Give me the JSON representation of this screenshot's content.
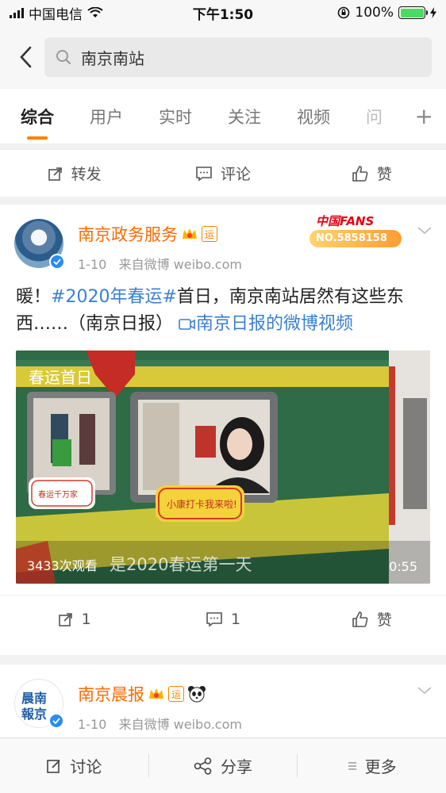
{
  "status": {
    "carrier": "中国电信",
    "time": "下午1:50",
    "battery": "100%",
    "battery_level": 1.0
  },
  "search": {
    "query": "南京南站"
  },
  "tabs": [
    {
      "label": "综合"
    },
    {
      "label": "用户"
    },
    {
      "label": "实时"
    },
    {
      "label": "关注"
    },
    {
      "label": "视频"
    },
    {
      "label": "问"
    }
  ],
  "top_actions": {
    "repost": "转发",
    "comment": "评论",
    "like": "赞"
  },
  "post1": {
    "author": "南京政务服务",
    "badge": "运",
    "time": "1-10",
    "source": "来自微博 weibo.com",
    "fans_label": "中国FANS",
    "fans_no": "NO.5858158",
    "text_before": "暖！",
    "hashtag": "#2020年春运#",
    "text_after": "首日，南京南站居然有这些东西……（南京日报）",
    "link": "南京日报的微博视频",
    "video": {
      "title": "春运首日",
      "views": "3433次观看",
      "caption": "是2020春运第一天",
      "duration": "0:55",
      "sign1": "小康打卡我来啦!",
      "sign2": "春运千万家"
    },
    "actions": {
      "repost": "1",
      "comment": "1",
      "like": "赞"
    }
  },
  "post2": {
    "author": "南京晨报",
    "badge": "运",
    "time": "1-10",
    "source": "来自微博 weibo.com",
    "avatar_text": "晨南\n報京"
  },
  "bottom_bar": {
    "discuss": "讨论",
    "share": "分享",
    "more": "更多"
  },
  "colors": {
    "accent": "#ff8200",
    "name": "#ff6a00",
    "link": "#3b7fd1",
    "verified": "#2a8cf0"
  }
}
